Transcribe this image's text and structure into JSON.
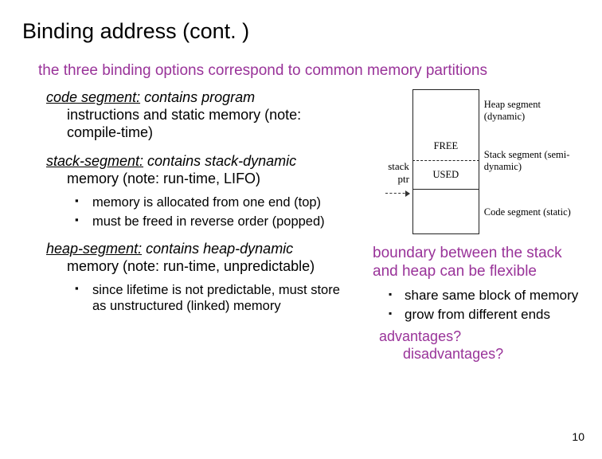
{
  "title": "Binding address (cont. )",
  "intro": "the three binding options correspond to common memory partitions",
  "segments": {
    "code": {
      "name": "code segment:",
      "desc_line1": " contains program",
      "desc_rest": "instructions and static memory (note: compile-time)"
    },
    "stack": {
      "name": "stack-segment:",
      "desc_line1": " contains stack-dynamic",
      "desc_rest": "memory (note: run-time, LIFO)",
      "bullets": [
        "memory is allocated from one end (top)",
        "must be freed in reverse order (popped)"
      ]
    },
    "heap": {
      "name": "heap-segment:",
      "desc_line1": " contains heap-dynamic",
      "desc_rest": "memory (note: run-time, unpredictable)",
      "bullets": [
        "since lifetime is not predictable, must store as unstructured (linked) memory"
      ]
    }
  },
  "diagram": {
    "stack_ptr": "stack ptr",
    "free": "FREE",
    "used": "USED",
    "heap_label": "Heap segment (dynamic)",
    "stack_label": "Stack segment (semi-dynamic)",
    "code_label": "Code segment (static)"
  },
  "boundary": "boundary between the stack and heap can be flexible",
  "right_bullets": [
    "share same block of memory",
    "grow from different ends"
  ],
  "qa": {
    "adv": "advantages?",
    "dis": "disadvantages?"
  },
  "page_num": "10"
}
